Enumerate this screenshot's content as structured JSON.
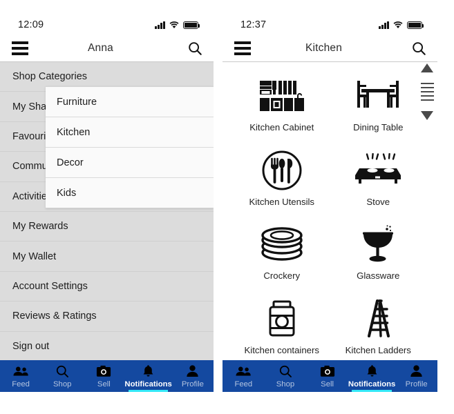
{
  "left_phone": {
    "status": {
      "time": "12:09",
      "signal_icon": "signal-bars-icon",
      "wifi_icon": "wifi-icon",
      "battery_icon": "battery-icon"
    },
    "nav": {
      "menu_icon": "hamburger-menu-icon",
      "title": "Anna",
      "search_icon": "search-icon"
    },
    "drawer": {
      "items": [
        {
          "label": "Shop Categories",
          "name": "drawer-item-shop-categories"
        },
        {
          "label": "My Sha",
          "name": "drawer-item-my-shares"
        },
        {
          "label": "Favourit",
          "name": "drawer-item-favourites"
        },
        {
          "label": "Commu",
          "name": "drawer-item-community"
        },
        {
          "label": "Activitie",
          "name": "drawer-item-activities"
        },
        {
          "label": "My Rewards",
          "name": "drawer-item-my-rewards"
        },
        {
          "label": "My Wallet",
          "name": "drawer-item-my-wallet"
        },
        {
          "label": "Account Settings",
          "name": "drawer-item-account-settings"
        },
        {
          "label": "Reviews & Ratings",
          "name": "drawer-item-reviews-ratings"
        },
        {
          "label": "Sign out",
          "name": "drawer-item-sign-out"
        }
      ]
    },
    "submenu": {
      "items": [
        {
          "label": "Furniture"
        },
        {
          "label": "Kitchen"
        },
        {
          "label": "Decor"
        },
        {
          "label": "Kids"
        }
      ]
    },
    "tabs": [
      {
        "label": "Feed",
        "icon": "people-icon",
        "active": false
      },
      {
        "label": "Shop",
        "icon": "search-icon",
        "active": false
      },
      {
        "label": "Sell",
        "icon": "camera-icon",
        "active": false
      },
      {
        "label": "Notifications",
        "icon": "bell-icon",
        "active": true
      },
      {
        "label": "Profile",
        "icon": "person-icon",
        "active": false
      }
    ]
  },
  "right_phone": {
    "status": {
      "time": "12:37",
      "signal_icon": "signal-bars-icon",
      "wifi_icon": "wifi-icon",
      "battery_icon": "battery-icon"
    },
    "nav": {
      "menu_icon": "hamburger-menu-icon",
      "title": "Kitchen",
      "search_icon": "search-icon"
    },
    "scrollbar": {
      "up_icon": "triangle-up-icon",
      "down_icon": "triangle-down-icon"
    },
    "categories": [
      {
        "label": "Kitchen Cabinet",
        "icon": "kitchen-cabinet-icon"
      },
      {
        "label": "Dining Table",
        "icon": "dining-table-icon"
      },
      {
        "label": "Kitchen Utensils",
        "icon": "kitchen-utensils-icon"
      },
      {
        "label": "Stove",
        "icon": "stove-icon"
      },
      {
        "label": "Crockery",
        "icon": "crockery-icon"
      },
      {
        "label": "Glassware",
        "icon": "glassware-icon"
      },
      {
        "label": "Kitchen containers",
        "icon": "kitchen-container-icon"
      },
      {
        "label": "Kitchen Ladders",
        "icon": "kitchen-ladder-icon"
      }
    ],
    "tabs": [
      {
        "label": "Feed",
        "icon": "people-icon",
        "active": false
      },
      {
        "label": "Shop",
        "icon": "search-icon",
        "active": false
      },
      {
        "label": "Sell",
        "icon": "camera-icon",
        "active": false
      },
      {
        "label": "Notifications",
        "icon": "bell-icon",
        "active": true
      },
      {
        "label": "Profile",
        "icon": "person-icon",
        "active": false
      }
    ]
  },
  "colors": {
    "tabbar_blue": "#1449a0",
    "accent_cyan": "#35e9f7",
    "drawer_gray": "#dcdcdc",
    "submenu_white": "#fafafa"
  }
}
